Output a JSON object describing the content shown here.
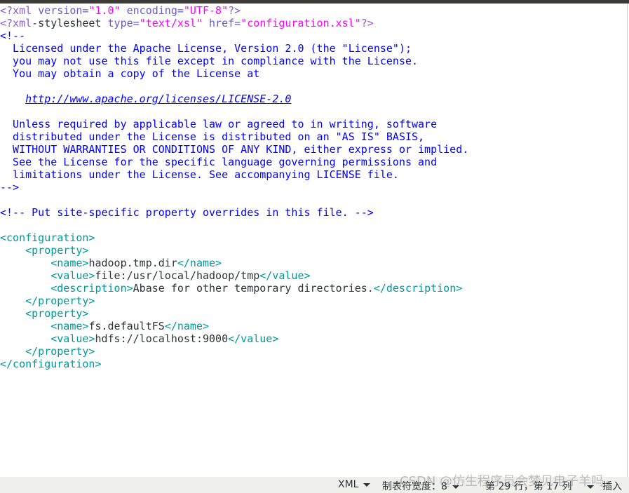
{
  "editor": {
    "language": "XML",
    "lines": [
      [
        [
          "pi",
          "<?xml "
        ],
        [
          "attr",
          "version="
        ],
        [
          "str",
          "\"1.0\" "
        ],
        [
          "attr",
          "encoding="
        ],
        [
          "str",
          "\"UTF-8\""
        ],
        [
          "pi",
          "?>"
        ]
      ],
      [
        [
          "pi",
          "<?xml"
        ],
        [
          "plain",
          "-stylesheet "
        ],
        [
          "attr",
          "type="
        ],
        [
          "str",
          "\"text/xsl\" "
        ],
        [
          "attr",
          "href="
        ],
        [
          "str",
          "\"configuration.xsl\""
        ],
        [
          "pi",
          "?>"
        ]
      ],
      [
        [
          "cm",
          "<!--"
        ]
      ],
      [
        [
          "cm",
          "  Licensed under the Apache License, Version 2.0 (the \"License\");"
        ]
      ],
      [
        [
          "cm",
          "  you may not use this file except in compliance with the License."
        ]
      ],
      [
        [
          "cm",
          "  You may obtain a copy of the License at"
        ]
      ],
      [],
      [
        [
          "cm",
          "    "
        ],
        [
          "url",
          "http://www.apache.org/licenses/LICENSE-2.0"
        ]
      ],
      [],
      [
        [
          "cm",
          "  Unless required by applicable law or agreed to in writing, software"
        ]
      ],
      [
        [
          "cm",
          "  distributed under the License is distributed on an \"AS IS\" BASIS,"
        ]
      ],
      [
        [
          "cm",
          "  WITHOUT WARRANTIES OR CONDITIONS OF ANY KIND, either express or implied."
        ]
      ],
      [
        [
          "cm",
          "  See the License for the specific language governing permissions and"
        ]
      ],
      [
        [
          "cm",
          "  limitations under the License. See accompanying LICENSE file."
        ]
      ],
      [
        [
          "cm",
          "-->"
        ]
      ],
      [],
      [
        [
          "cm",
          "<!-- Put site-specific property overrides in this file. -->"
        ]
      ],
      [],
      [
        [
          "tag",
          "<configuration>"
        ]
      ],
      [
        [
          "plain",
          "    "
        ],
        [
          "tag",
          "<property>"
        ]
      ],
      [
        [
          "plain",
          "        "
        ],
        [
          "tag",
          "<name>"
        ],
        [
          "plain",
          "hadoop.tmp.dir"
        ],
        [
          "tag",
          "</name>"
        ]
      ],
      [
        [
          "plain",
          "        "
        ],
        [
          "tag",
          "<value>"
        ],
        [
          "plain",
          "file:/usr/local/hadoop/tmp"
        ],
        [
          "tag",
          "</value>"
        ]
      ],
      [
        [
          "plain",
          "        "
        ],
        [
          "tag",
          "<description>"
        ],
        [
          "plain",
          "Abase for other temporary directories."
        ],
        [
          "tag",
          "</description>"
        ]
      ],
      [
        [
          "plain",
          "    "
        ],
        [
          "tag",
          "</property>"
        ]
      ],
      [
        [
          "plain",
          "    "
        ],
        [
          "tag",
          "<property>"
        ]
      ],
      [
        [
          "plain",
          "        "
        ],
        [
          "tag",
          "<name>"
        ],
        [
          "plain",
          "fs.defaultFS"
        ],
        [
          "tag",
          "</name>"
        ]
      ],
      [
        [
          "plain",
          "        "
        ],
        [
          "tag",
          "<value>"
        ],
        [
          "plain",
          "hdfs://localhost:9000"
        ],
        [
          "tag",
          "</value>"
        ]
      ],
      [
        [
          "plain",
          "    "
        ],
        [
          "tag",
          "</property>"
        ]
      ],
      [
        [
          "tag",
          "</configuration>"
        ]
      ]
    ]
  },
  "statusbar": {
    "language": "XML",
    "tab_width": "制表符宽度：8",
    "position": "第 29 行，第 17 列",
    "mode": "插入"
  },
  "watermark": "CSDN @仿生程序员会梦见电子羊吗"
}
